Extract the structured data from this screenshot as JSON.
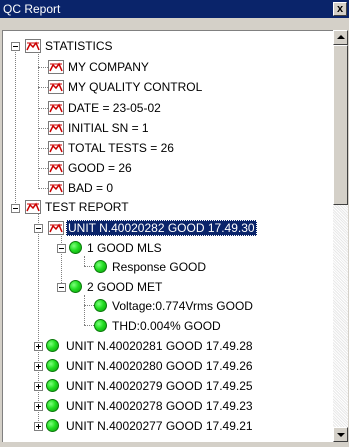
{
  "window": {
    "title": "QC Report",
    "close_glyph": "x"
  },
  "tree": {
    "statistics": {
      "label": "STATISTICS",
      "items": [
        "MY COMPANY",
        "MY QUALITY CONTROL",
        "DATE = 23-05-02",
        "INITIAL SN = 1",
        "TOTAL TESTS = 26",
        "GOOD = 26",
        "BAD = 0"
      ]
    },
    "test_report": {
      "label": "TEST REPORT",
      "selected_unit": {
        "label": "UNIT N.40020282 GOOD 17.49.30",
        "test1": {
          "label": "1   GOOD MLS",
          "child": "Response GOOD"
        },
        "test2": {
          "label": "2   GOOD MET",
          "children": [
            "Voltage:0.774Vrms GOOD",
            "THD:0.004% GOOD"
          ]
        }
      },
      "units": [
        "UNIT N.40020281 GOOD 17.49.28",
        "UNIT N.40020280 GOOD 17.49.26",
        "UNIT N.40020279 GOOD 17.49.25",
        "UNIT N.40020278 GOOD 17.49.23",
        "UNIT N.40020277 GOOD 17.49.21"
      ]
    }
  },
  "icons": {
    "report": "chart-icon",
    "test_ok": "green-status-dot-icon"
  },
  "colors": {
    "selection": "#0a246a",
    "status_good": "#22dd22",
    "chart_line": "#cc0000"
  }
}
